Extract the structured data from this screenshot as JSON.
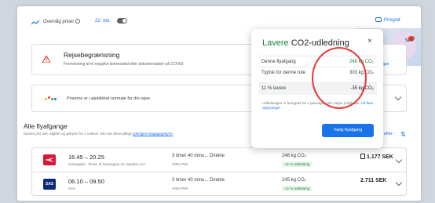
{
  "topbar": {
    "track_prices": "Overvåg priser",
    "track_date": "22. okt.",
    "price_graph": "Prisgraf",
    "map_label": "SEK"
  },
  "travel_card": {
    "title": "Rejsebegrænsning",
    "description": "Fremvisning af et negativt testresultat eller dokumentation på COVID-",
    "link": "ninger"
  },
  "normal_card": {
    "text": "Priserne er i øjeblikket normale for din rejse."
  },
  "all_flights": {
    "title": "Alle flyafgange",
    "subtitle": "Samlet pris inkl. afgifter og gebyrer for 1 voksen. Der kan blive pålagt",
    "subtitle_link": "yderligere bagagegebyrer",
    "sort_label": "orter efter:"
  },
  "flights": [
    {
      "time": "16.45 – 20.25",
      "airline": "Norwegian · Flown af Norwegian Air Sweden Aoc",
      "duration": "3 timer 40 minu... Direkte",
      "route": "ARN–PMI",
      "co2": "248 kg CO₂",
      "co2_badge": "-11 % udledning",
      "price": "1.177 SEK"
    },
    {
      "time": "06.10 – 09.50",
      "airline": "SAS",
      "duration": "3 timer 40 minu... Direkte",
      "route": "ARN–PMI",
      "co2": "245 kg CO₂",
      "co2_badge": "-11 % udledning",
      "price": "2.711 SEK"
    }
  ],
  "popup": {
    "title_green": "Lavere",
    "title_rest": "CO2-udledning",
    "close": "×",
    "rows": [
      {
        "label": "Denne flyafgang",
        "value": "248 kg CO₂"
      },
      {
        "label": "Typisk for denne rute",
        "value": "303 kg CO₂"
      },
      {
        "label": "11 % lavere",
        "value": "-35 kg CO₂"
      }
    ],
    "description": "Udledningen er beregnet for 1 passager i din valgte prisklasse.",
    "description_link": "Få flere oplysninger",
    "button": "Vælg flyafgang"
  },
  "colors": {
    "accent": "#1a73e8",
    "green": "#188038",
    "annotation_circle": "#e53935",
    "warning": "#d93025"
  }
}
